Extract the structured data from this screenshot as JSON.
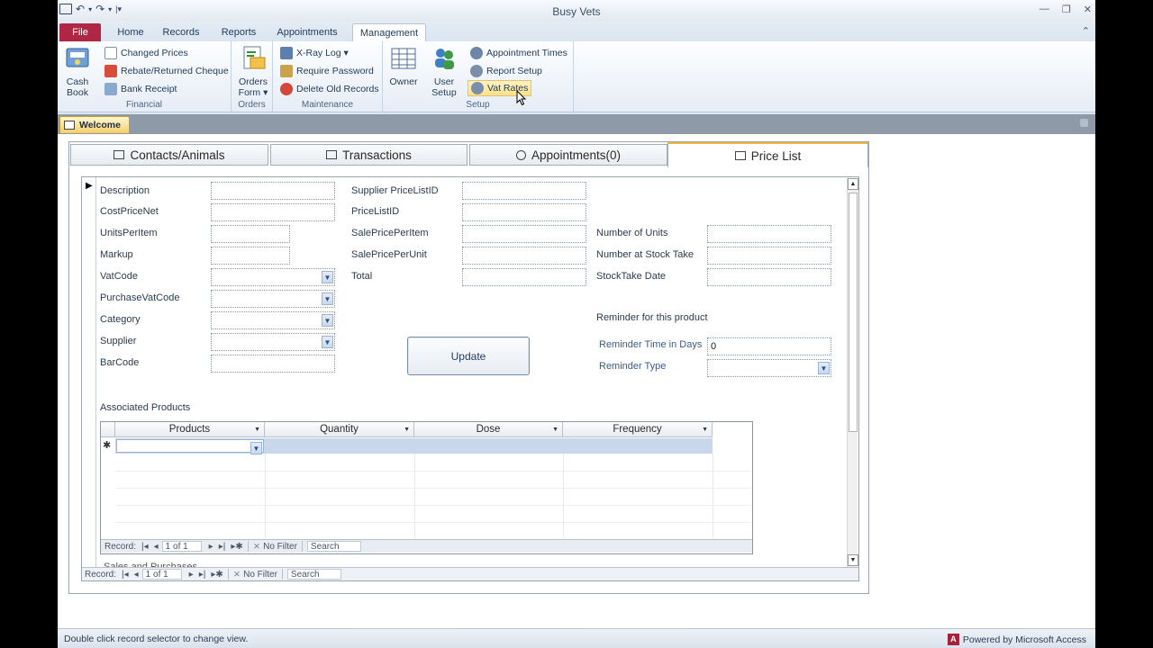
{
  "window": {
    "title": "Busy Vets"
  },
  "ribbon_tabs": [
    "File",
    "Home",
    "Records",
    "Reports",
    "Appointments",
    "Management"
  ],
  "ribbon": {
    "financial": {
      "label": "Financial",
      "cash_book": "Cash Book",
      "cash_book_l1": "Cash",
      "cash_book_l2": "Book",
      "changed_prices": "Changed Prices",
      "rebate": "Rebate/Returned Cheque",
      "bank_receipt": "Bank Receipt"
    },
    "orders": {
      "label": "Orders",
      "l1": "Orders",
      "l2": "Form ▾"
    },
    "maintenance": {
      "label": "Maintenance",
      "xray": "X-Ray Log ▾",
      "require_password": "Require Password",
      "delete_old": "Delete Old Records"
    },
    "setup": {
      "label": "Setup",
      "owner": "Owner",
      "user_setup_l1": "User",
      "user_setup_l2": "Setup",
      "appointment_times": "Appointment Times",
      "report_setup": "Report Setup",
      "vat_rates": "Vat Rates"
    }
  },
  "doc_tab": {
    "label": "Welcome"
  },
  "form_tabs": [
    "Contacts/Animals",
    "Transactions",
    "Appointments(0)",
    "Price List"
  ],
  "fields": {
    "description": "Description",
    "cost_price_net": "CostPriceNet",
    "units_per_item": "UnitsPerItem",
    "markup": "Markup",
    "vat_code": "VatCode",
    "purchase_vat_code": "PurchaseVatCode",
    "category": "Category",
    "supplier": "Supplier",
    "barcode": "BarCode",
    "supplier_pricelist_id": "Supplier PriceListID",
    "pricelist_id": "PriceListID",
    "sale_price_per_item": "SalePricePerItem",
    "sale_price_per_unit": "SalePricePerUnit",
    "total": "Total",
    "number_of_units": "Number of Units",
    "number_at_stock_take": "Number at Stock Take",
    "stocktake_date": "StockTake Date",
    "reminder_heading": "Reminder for this product",
    "reminder_time": "Reminder Time in Days",
    "reminder_time_value": "0",
    "reminder_type": "Reminder Type"
  },
  "update_button": "Update",
  "associated": {
    "heading": "Associated Products",
    "columns": [
      "Products",
      "Quantity",
      "Dose",
      "Frequency"
    ],
    "new_row_marker": "✱"
  },
  "subnav": {
    "record": "Record:",
    "pos": "1 of 1",
    "filter": "No Filter",
    "search": "Search"
  },
  "mainnav": {
    "record": "Record:",
    "pos": "1 of 1",
    "filter": "No Filter",
    "search": "Search"
  },
  "sales_heading": "Sales and Purchases",
  "status": {
    "left": "Double click record selector to change view.",
    "right": "Powered by Microsoft Access"
  }
}
